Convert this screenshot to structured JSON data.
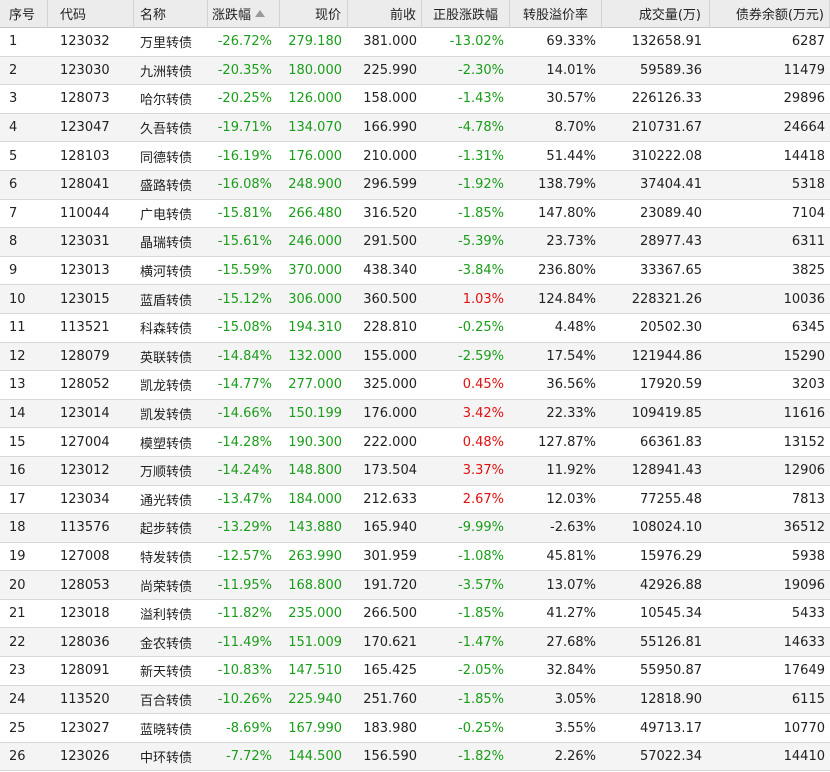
{
  "columns": {
    "seq": "序号",
    "code": "代码",
    "name": "名称",
    "change": "涨跌幅",
    "price": "现价",
    "prev_close": "前收",
    "stock_change": "正股涨跌幅",
    "premium": "转股溢价率",
    "volume": "成交量(万)",
    "balance": "债券余额(万元)"
  },
  "colors": {
    "down": "#1a9d1a",
    "up": "#e01010"
  },
  "rows": [
    {
      "seq": "1",
      "code": "123032",
      "name": "万里转债",
      "change": "-26.72%",
      "price": "279.180",
      "prev": "381.000",
      "stock": "-13.02%",
      "premium": "69.33%",
      "volume": "132658.91",
      "balance": "6287"
    },
    {
      "seq": "2",
      "code": "123030",
      "name": "九洲转债",
      "change": "-20.35%",
      "price": "180.000",
      "prev": "225.990",
      "stock": "-2.30%",
      "premium": "14.01%",
      "volume": "59589.36",
      "balance": "11479"
    },
    {
      "seq": "3",
      "code": "128073",
      "name": "哈尔转债",
      "change": "-20.25%",
      "price": "126.000",
      "prev": "158.000",
      "stock": "-1.43%",
      "premium": "30.57%",
      "volume": "226126.33",
      "balance": "29896"
    },
    {
      "seq": "4",
      "code": "123047",
      "name": "久吾转债",
      "change": "-19.71%",
      "price": "134.070",
      "prev": "166.990",
      "stock": "-4.78%",
      "premium": "8.70%",
      "volume": "210731.67",
      "balance": "24664"
    },
    {
      "seq": "5",
      "code": "128103",
      "name": "同德转债",
      "change": "-16.19%",
      "price": "176.000",
      "prev": "210.000",
      "stock": "-1.31%",
      "premium": "51.44%",
      "volume": "310222.08",
      "balance": "14418"
    },
    {
      "seq": "6",
      "code": "128041",
      "name": "盛路转债",
      "change": "-16.08%",
      "price": "248.900",
      "prev": "296.599",
      "stock": "-1.92%",
      "premium": "138.79%",
      "volume": "37404.41",
      "balance": "5318"
    },
    {
      "seq": "7",
      "code": "110044",
      "name": "广电转债",
      "change": "-15.81%",
      "price": "266.480",
      "prev": "316.520",
      "stock": "-1.85%",
      "premium": "147.80%",
      "volume": "23089.40",
      "balance": "7104"
    },
    {
      "seq": "8",
      "code": "123031",
      "name": "晶瑞转债",
      "change": "-15.61%",
      "price": "246.000",
      "prev": "291.500",
      "stock": "-5.39%",
      "premium": "23.73%",
      "volume": "28977.43",
      "balance": "6311"
    },
    {
      "seq": "9",
      "code": "123013",
      "name": "横河转债",
      "change": "-15.59%",
      "price": "370.000",
      "prev": "438.340",
      "stock": "-3.84%",
      "premium": "236.80%",
      "volume": "33367.65",
      "balance": "3825"
    },
    {
      "seq": "10",
      "code": "123015",
      "name": "蓝盾转债",
      "change": "-15.12%",
      "price": "306.000",
      "prev": "360.500",
      "stock": "1.03%",
      "premium": "124.84%",
      "volume": "228321.26",
      "balance": "10036"
    },
    {
      "seq": "11",
      "code": "113521",
      "name": "科森转债",
      "change": "-15.08%",
      "price": "194.310",
      "prev": "228.810",
      "stock": "-0.25%",
      "premium": "4.48%",
      "volume": "20502.30",
      "balance": "6345"
    },
    {
      "seq": "12",
      "code": "128079",
      "name": "英联转债",
      "change": "-14.84%",
      "price": "132.000",
      "prev": "155.000",
      "stock": "-2.59%",
      "premium": "17.54%",
      "volume": "121944.86",
      "balance": "15290"
    },
    {
      "seq": "13",
      "code": "128052",
      "name": "凯龙转债",
      "change": "-14.77%",
      "price": "277.000",
      "prev": "325.000",
      "stock": "0.45%",
      "premium": "36.56%",
      "volume": "17920.59",
      "balance": "3203"
    },
    {
      "seq": "14",
      "code": "123014",
      "name": "凯发转债",
      "change": "-14.66%",
      "price": "150.199",
      "prev": "176.000",
      "stock": "3.42%",
      "premium": "22.33%",
      "volume": "109419.85",
      "balance": "11616"
    },
    {
      "seq": "15",
      "code": "127004",
      "name": "模塑转债",
      "change": "-14.28%",
      "price": "190.300",
      "prev": "222.000",
      "stock": "0.48%",
      "premium": "127.87%",
      "volume": "66361.83",
      "balance": "13152"
    },
    {
      "seq": "16",
      "code": "123012",
      "name": "万顺转债",
      "change": "-14.24%",
      "price": "148.800",
      "prev": "173.504",
      "stock": "3.37%",
      "premium": "11.92%",
      "volume": "128941.43",
      "balance": "12906"
    },
    {
      "seq": "17",
      "code": "123034",
      "name": "通光转债",
      "change": "-13.47%",
      "price": "184.000",
      "prev": "212.633",
      "stock": "2.67%",
      "premium": "12.03%",
      "volume": "77255.48",
      "balance": "7813"
    },
    {
      "seq": "18",
      "code": "113576",
      "name": "起步转债",
      "change": "-13.29%",
      "price": "143.880",
      "prev": "165.940",
      "stock": "-9.99%",
      "premium": "-2.63%",
      "volume": "108024.10",
      "balance": "36512"
    },
    {
      "seq": "19",
      "code": "127008",
      "name": "特发转债",
      "change": "-12.57%",
      "price": "263.990",
      "prev": "301.959",
      "stock": "-1.08%",
      "premium": "45.81%",
      "volume": "15976.29",
      "balance": "5938"
    },
    {
      "seq": "20",
      "code": "128053",
      "name": "尚荣转债",
      "change": "-11.95%",
      "price": "168.800",
      "prev": "191.720",
      "stock": "-3.57%",
      "premium": "13.07%",
      "volume": "42926.88",
      "balance": "19096"
    },
    {
      "seq": "21",
      "code": "123018",
      "name": "溢利转债",
      "change": "-11.82%",
      "price": "235.000",
      "prev": "266.500",
      "stock": "-1.85%",
      "premium": "41.27%",
      "volume": "10545.34",
      "balance": "5433"
    },
    {
      "seq": "22",
      "code": "128036",
      "name": "金农转债",
      "change": "-11.49%",
      "price": "151.009",
      "prev": "170.621",
      "stock": "-1.47%",
      "premium": "27.68%",
      "volume": "55126.81",
      "balance": "14633"
    },
    {
      "seq": "23",
      "code": "128091",
      "name": "新天转债",
      "change": "-10.83%",
      "price": "147.510",
      "prev": "165.425",
      "stock": "-2.05%",
      "premium": "32.84%",
      "volume": "55950.87",
      "balance": "17649"
    },
    {
      "seq": "24",
      "code": "113520",
      "name": "百合转债",
      "change": "-10.26%",
      "price": "225.940",
      "prev": "251.760",
      "stock": "-1.85%",
      "premium": "3.05%",
      "volume": "12818.90",
      "balance": "6115"
    },
    {
      "seq": "25",
      "code": "123027",
      "name": "蓝晓转债",
      "change": "-8.69%",
      "price": "167.990",
      "prev": "183.980",
      "stock": "-0.25%",
      "premium": "3.55%",
      "volume": "49713.17",
      "balance": "10770"
    },
    {
      "seq": "26",
      "code": "123026",
      "name": "中环转债",
      "change": "-7.72%",
      "price": "144.500",
      "prev": "156.590",
      "stock": "-1.82%",
      "premium": "2.26%",
      "volume": "57022.34",
      "balance": "14410"
    }
  ]
}
